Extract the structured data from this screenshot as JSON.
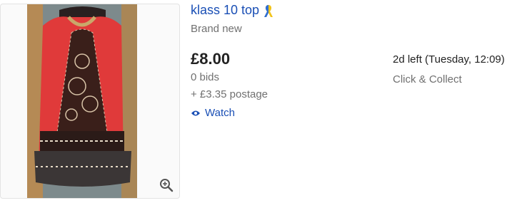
{
  "listing": {
    "title": "klass 10 top",
    "condition": "Brand new",
    "price": "£8.00",
    "bids": "0 bids",
    "postage": "+ £3.35 postage",
    "watch_label": "Watch",
    "time_left": "2d left (Tuesday, 12:09)",
    "delivery": "Click & Collect"
  },
  "icons": {
    "ribbon": "awareness-ribbon-icon",
    "watch": "eye-icon",
    "zoom": "zoom-in-icon"
  },
  "colors": {
    "link": "#1a4fb5",
    "muted": "#707070",
    "ribbon_blue": "#2f6fd6",
    "ribbon_yellow": "#f2c318",
    "dress_red": "#e03a3a"
  }
}
